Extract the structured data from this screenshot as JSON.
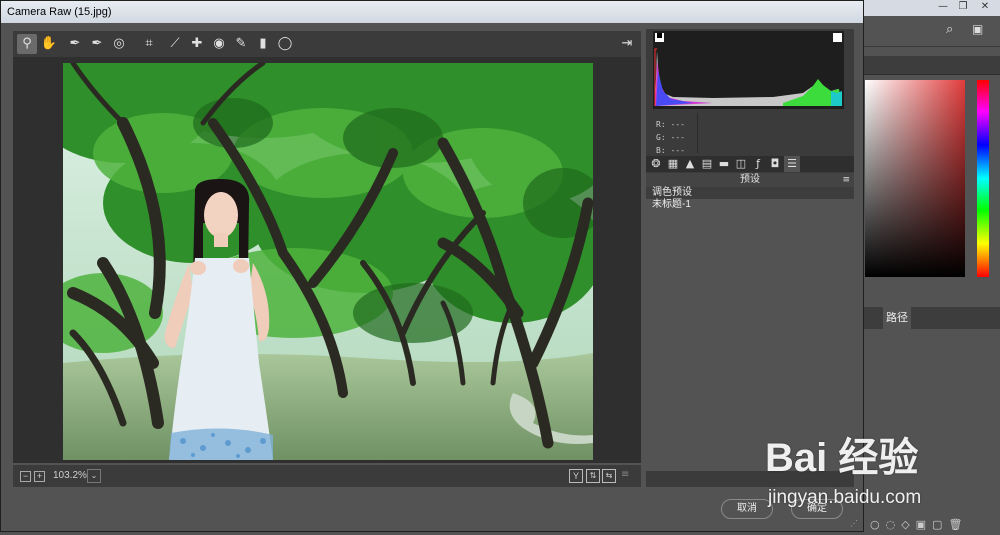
{
  "dialog": {
    "title": "Camera Raw (15.jpg)",
    "cancel_label": "取消",
    "ok_label": "确定"
  },
  "toolbar": {
    "tools": [
      {
        "name": "zoom-tool",
        "glyph": "🔍",
        "active": true
      },
      {
        "name": "hand-tool",
        "glyph": "✋"
      },
      {
        "name": "white-balance-tool",
        "glyph": "✒"
      },
      {
        "name": "color-sampler-tool",
        "glyph": "✒"
      },
      {
        "name": "targeted-adjustment-tool",
        "glyph": "◎"
      },
      {
        "name": "crop-tool",
        "glyph": "⌗"
      },
      {
        "name": "straighten-tool",
        "glyph": "⟋"
      },
      {
        "name": "spot-removal-tool",
        "glyph": "✚"
      },
      {
        "name": "red-eye-tool",
        "glyph": "👁"
      },
      {
        "name": "adjustment-brush-tool",
        "glyph": "✎"
      },
      {
        "name": "graduated-filter-tool",
        "glyph": "▮"
      },
      {
        "name": "radial-filter-tool",
        "glyph": "◯"
      }
    ],
    "open_prefs_icon": "preferences-icon"
  },
  "status": {
    "zoom_value": "103.2%"
  },
  "rgb_readout": {
    "r_label": "R:",
    "r_value": "---",
    "g_label": "G:",
    "g_value": "---",
    "b_label": "B:",
    "b_value": "---"
  },
  "panel": {
    "header": "预设",
    "presets": [
      {
        "label": "调色预设",
        "selected": true
      },
      {
        "label": "未标题-1",
        "selected": false
      }
    ]
  },
  "photoshop": {
    "paths_tab_label": "路径"
  },
  "watermark": {
    "logo": "Bai 经验",
    "url": "jingyan.baidu.com"
  }
}
